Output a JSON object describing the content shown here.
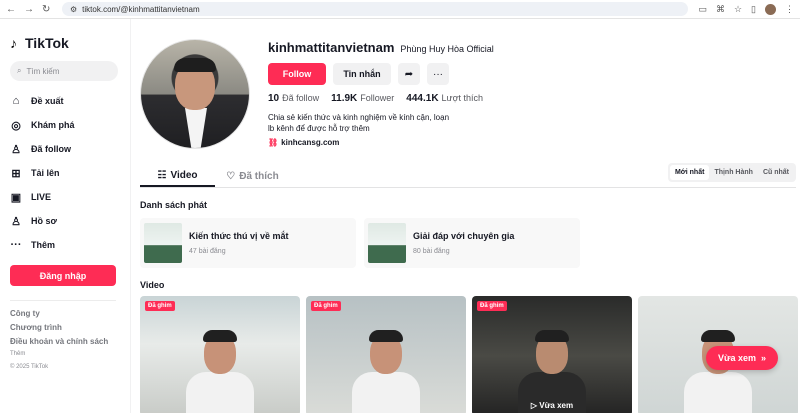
{
  "browser": {
    "url": "tiktok.com/@kinhmattitanvietnam"
  },
  "sidebar": {
    "logo": "TikTok",
    "search_placeholder": "Tìm kiếm",
    "items": [
      {
        "icon": "home-icon",
        "glyph": "⌂",
        "label": "Đề xuất"
      },
      {
        "icon": "compass-icon",
        "glyph": "◎",
        "label": "Khám phá"
      },
      {
        "icon": "following-icon",
        "glyph": "♙",
        "label": "Đã follow"
      },
      {
        "icon": "upload-icon",
        "glyph": "⊞",
        "label": "Tải lên"
      },
      {
        "icon": "live-icon",
        "glyph": "▣",
        "label": "LIVE"
      },
      {
        "icon": "profile-icon",
        "glyph": "♙",
        "label": "Hồ sơ"
      },
      {
        "icon": "more-icon",
        "glyph": "···",
        "label": "Thêm"
      }
    ],
    "login": "Đăng nhập",
    "footer": {
      "company": "Công ty",
      "program": "Chương trình",
      "terms": "Điều khoản và chính sách",
      "more": "Thêm",
      "copyright": "© 2025 TikTok"
    }
  },
  "profile": {
    "username": "kinhmattitanvietnam",
    "nickname": "Phùng Huy Hòa Official",
    "follow": "Follow",
    "message": "Tin nhắn",
    "following_count": "10",
    "following_label": "Đã follow",
    "followers_count": "11.9K",
    "followers_label": "Follower",
    "likes_count": "444.1K",
    "likes_label": "Lượt thích",
    "bio_line1": "Chia sẻ kiến thức và kinh nghiệm về kính cận, loạn",
    "bio_line2": "lb kênh để được hỗ trợ thêm",
    "link": "kinhcansg.com"
  },
  "tabs": {
    "video": "Video",
    "liked": "Đã thích"
  },
  "sort": {
    "newest": "Mới nhất",
    "popular": "Thịnh Hành",
    "oldest": "Cũ nhất"
  },
  "playlists_title": "Danh sách phát",
  "playlists": [
    {
      "title": "Kiến thức thú vị về mắt",
      "count": "47 bài đăng"
    },
    {
      "title": "Giải đáp với chuyên gia",
      "count": "80 bài đăng"
    }
  ],
  "videos_title": "Video",
  "videos": [
    {
      "badge": "Đã ghim"
    },
    {
      "badge": "Đã ghim"
    },
    {
      "badge": "Đã ghim",
      "watch": "▷ Vừa xem"
    },
    {
      "badge": ""
    }
  ],
  "float_button": "Vừa xem"
}
